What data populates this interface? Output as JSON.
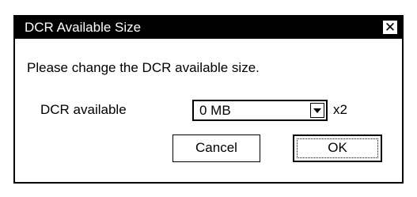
{
  "dialog": {
    "title": "DCR Available Size",
    "close_glyph": "✕",
    "message": "Please change the DCR available size.",
    "field_label": "DCR available",
    "select_value": "0 MB",
    "multiplier": "x2",
    "cancel_label": "Cancel",
    "ok_label": "OK"
  },
  "icons": {
    "close": "close-icon",
    "dropdown": "chevron-down-icon"
  },
  "colors": {
    "titlebar_bg": "#000000",
    "titlebar_text": "#ffffff",
    "dialog_bg": "#ffffff"
  }
}
